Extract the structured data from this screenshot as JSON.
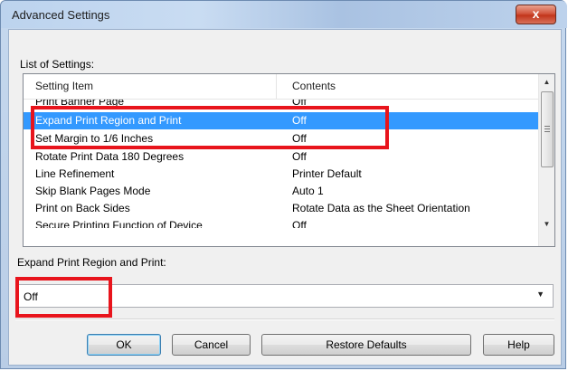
{
  "window": {
    "title": "Advanced Settings",
    "close_symbol": "x",
    "close_icon": "close-icon"
  },
  "settings_list": {
    "label": "List of Settings:",
    "columns": [
      "Setting Item",
      "Contents"
    ],
    "rows": [
      {
        "item": "Print Banner Page",
        "content": "Off"
      },
      {
        "item": "Expand Print Region and Print",
        "content": "Off",
        "selected": true
      },
      {
        "item": "Set Margin to 1/6 Inches",
        "content": "Off"
      },
      {
        "item": "Rotate Print Data 180 Degrees",
        "content": "Off"
      },
      {
        "item": "Line Refinement",
        "content": "Printer Default"
      },
      {
        "item": "Skip Blank Pages Mode",
        "content": "Auto 1"
      },
      {
        "item": "Print on Back Sides",
        "content": "Rotate Data as the Sheet Orientation"
      },
      {
        "item": "Secure Printing Function of Device",
        "content": "Off"
      }
    ],
    "scroll_up_icon": "chevron-up-icon",
    "scroll_down_icon": "chevron-down-icon"
  },
  "detail": {
    "label": "Expand Print Region and Print:",
    "value": "Off",
    "arrow_icon": "chevron-down-icon"
  },
  "buttons": {
    "ok": "OK",
    "cancel": "Cancel",
    "restore": "Restore Defaults",
    "help": "Help"
  },
  "colors": {
    "highlight_box": "#e8141c",
    "selection": "#3399ff"
  }
}
